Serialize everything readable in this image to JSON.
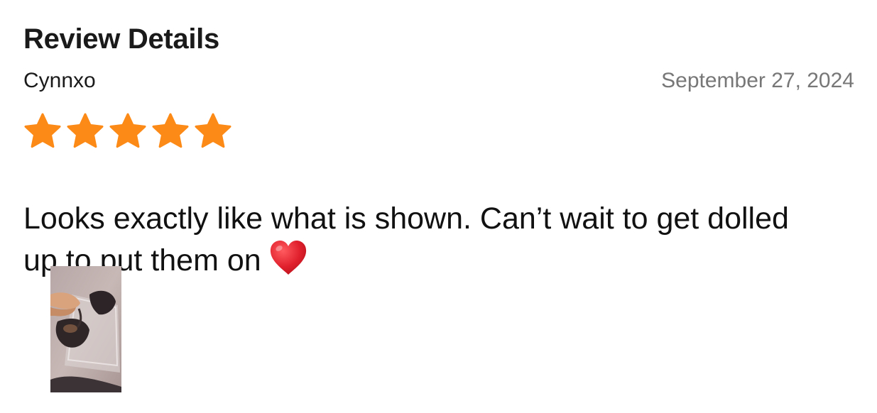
{
  "page": {
    "title": "Review Details"
  },
  "review": {
    "author": "Cynnxo",
    "date": "September 27, 2024",
    "rating": 5,
    "rating_max": 5,
    "text": "Looks exactly like what is shown. Can’t wait to get dolled up to put them on",
    "emoji": "heart-icon",
    "photos": [
      {
        "icon": "review-photo-thumbnail"
      }
    ]
  },
  "colors": {
    "star": "#fc8a17",
    "heart": "#e0202c",
    "date": "#777777",
    "text": "#111111"
  }
}
